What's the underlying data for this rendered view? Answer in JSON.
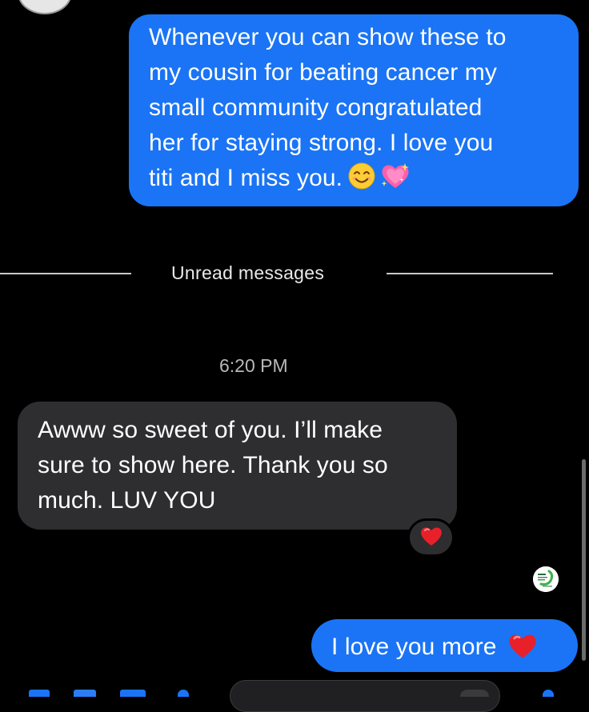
{
  "conversation": {
    "messages": [
      {
        "direction": "outgoing",
        "lines": [
          "Whenever you can show these to",
          "my cousin for beating cancer my",
          "small community congratulated",
          "her for staying strong. I love you",
          "titi and I miss you."
        ],
        "emojis": [
          "smiling-face",
          "sparkling-heart"
        ]
      },
      {
        "direction": "incoming",
        "lines": [
          "Awww so sweet of you. I’ll make",
          "sure to show here. Thank you so",
          "much. LUV YOU"
        ],
        "reaction": "red-heart"
      },
      {
        "direction": "outgoing",
        "text": "I love you more",
        "emoji": "red-heart"
      }
    ],
    "unread_divider": "Unread messages",
    "timestamp": "6:20 PM"
  },
  "colors": {
    "outgoing_bubble": "#1a74f5",
    "incoming_bubble": "#2e2e30",
    "background": "#000000",
    "heart": "#e8202a"
  }
}
